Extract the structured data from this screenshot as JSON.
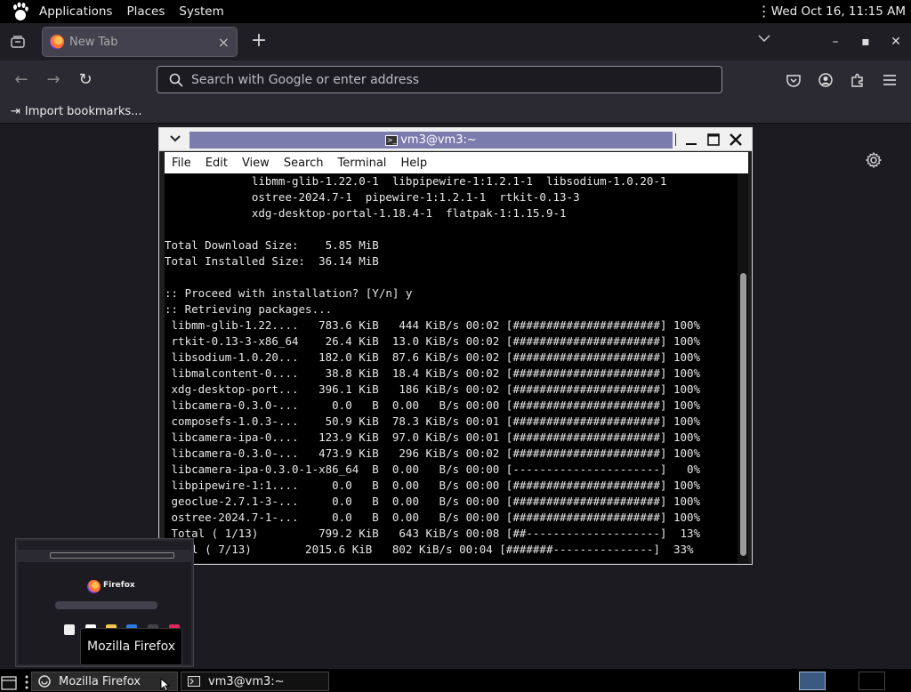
{
  "top_panel": {
    "menus": [
      "Applications",
      "Places",
      "System"
    ],
    "clock": "Wed Oct 16, 11:15 AM"
  },
  "firefox": {
    "tab": {
      "title": "New Tab"
    },
    "urlbar": {
      "placeholder": "Search with Google or enter address"
    },
    "bookmarks": {
      "import_label": "Import bookmarks..."
    }
  },
  "terminal": {
    "title": "vm3@vm3:~",
    "menus": [
      "File",
      "Edit",
      "View",
      "Search",
      "Terminal",
      "Help"
    ],
    "lines": [
      "             libmm-glib-1.22.0-1  libpipewire-1:1.2.1-1  libsodium-1.0.20-1",
      "             ostree-2024.7-1  pipewire-1:1.2.1-1  rtkit-0.13-3",
      "             xdg-desktop-portal-1.18.4-1  flatpak-1:1.15.9-1",
      "",
      "Total Download Size:    5.85 MiB",
      "Total Installed Size:  36.14 MiB",
      "",
      ":: Proceed with installation? [Y/n] y",
      ":: Retrieving packages...",
      " libmm-glib-1.22....   783.6 KiB   444 KiB/s 00:02 [######################] 100%",
      " rtkit-0.13-3-x86_64    26.4 KiB  13.0 KiB/s 00:02 [######################] 100%",
      " libsodium-1.0.20...   182.0 KiB  87.6 KiB/s 00:02 [######################] 100%",
      " libmalcontent-0....    38.8 KiB  18.4 KiB/s 00:02 [######################] 100%",
      " xdg-desktop-port...   396.1 KiB   186 KiB/s 00:02 [######################] 100%",
      " libcamera-0.3.0-...     0.0   B  0.00   B/s 00:00 [######################] 100%",
      " composefs-1.0.3-...    50.9 KiB  78.3 KiB/s 00:01 [######################] 100%",
      " libcamera-ipa-0....   123.9 KiB  97.0 KiB/s 00:01 [######################] 100%",
      " libcamera-0.3.0-...   473.9 KiB   296 KiB/s 00:02 [######################] 100%",
      " libcamera-ipa-0.3.0-1-x86_64  B  0.00   B/s 00:00 [----------------------]   0%",
      " libpipewire-1:1....     0.0   B  0.00   B/s 00:00 [######################] 100%",
      " geoclue-2.7.1-3-...     0.0   B  0.00   B/s 00:00 [######################] 100%",
      " ostree-2024.7-1-...     0.0   B  0.00   B/s 00:00 [######################] 100%",
      " Total ( 1/13)         799.2 KiB   643 KiB/s 00:08 [##--------------------]  13%",
      " otal ( 7/13)        2015.6 KiB   802 KiB/s 00:04 [#######---------------]  33%"
    ]
  },
  "preview": {
    "brand": "Firefox"
  },
  "tooltip": {
    "text": "Mozilla Firefox"
  },
  "taskbar": {
    "items": [
      {
        "label": "Mozilla Firefox"
      },
      {
        "label": "vm3@vm3:~"
      }
    ]
  },
  "colors": {
    "terminal_title_bg": "#7a7cad",
    "firefox_bg": "#1c1b22",
    "panel_bg": "#000000"
  }
}
